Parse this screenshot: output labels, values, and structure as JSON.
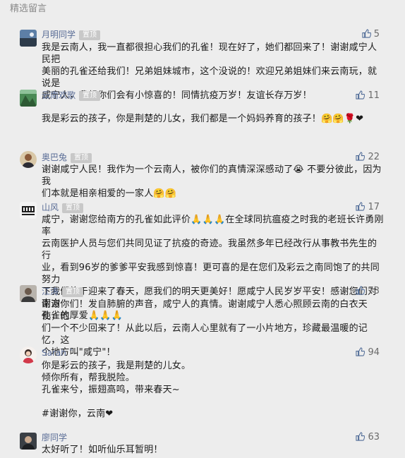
{
  "section_title": "精选留言",
  "pinned_label": "置顶",
  "comments": [
    {
      "nickname": "月明同学",
      "pinned": true,
      "likes": "5",
      "lines": [
        "我是云南人，我一直都很担心我们的孔雀！现在好了，她们都回来了！谢谢咸宁人民把",
        "美丽的孔雀还给我们！兄弟姐妹城市，这个没说的！欢迎兄弟姐妹们来云南玩，就说是",
        "咸宁人，我想你们会有小惊喜的！同情抗疫万岁！友谊长存万岁！"
      ]
    },
    {
      "nickname": "云南欢歌",
      "pinned": true,
      "likes": "11",
      "lines": [
        "",
        "我是彩云的孩子，你是荆楚的儿女，我们都是一个妈妈养育的孩子！🤗🤗🌹❤"
      ]
    },
    {
      "nickname": "奥巴兔",
      "pinned": true,
      "likes": "22",
      "lines": [
        "谢谢咸宁人民！我作为一个云南人，被你们的真情深深感动了😭 不要分彼此，因为我",
        "们本就是相亲相爱的一家人🤗🤗"
      ]
    },
    {
      "nickname": "山风",
      "pinned": true,
      "likes": "17",
      "lines": [
        "咸宁，谢谢您给南方的孔雀如此评价🙏🙏🙏在全球同抗瘟疫之时我的老班长许勇刚率",
        "云南医护人员与您们共同见证了抗疫的奇迹。我虽然多年已经改行从事教书先生的行",
        "业，看到96岁的爹爹平安我感到惊喜！更可喜的是在您们及彩云之南同饱了的共同努力",
        "下我们终于迎来了春天，愿我们的明天更美好！愿咸宁人民岁岁平安！感谢您们对南方",
        "孔雀的厚爱🙏🙏🙏"
      ]
    },
    {
      "nickname": "江涛",
      "pinned": true,
      "likes": "73",
      "lines": [
        "谢谢你们！发自肺腑的声音，咸宁人的真情。谢谢咸宁人悉心照顾云南的白衣天使，他",
        "们一个不少回来了！从此以后，云南人心里就有了一小片地方，珍藏最温暖的记忆，这",
        "个地方叫\"咸宁\"！"
      ]
    },
    {
      "nickname": "Sarah ˆ",
      "pinned": false,
      "likes": "94",
      "lines": [
        "你是彩云的孩子，我是荆楚的儿女。",
        "倾你所有，帮我脱险。",
        "孔雀来兮，振翅高鸣，带来春天~",
        "",
        "#谢谢你，云南❤"
      ]
    },
    {
      "nickname": "廖同学",
      "pinned": false,
      "likes": "63",
      "lines": [
        "太好听了！如听仙乐耳暂明！"
      ]
    }
  ]
}
